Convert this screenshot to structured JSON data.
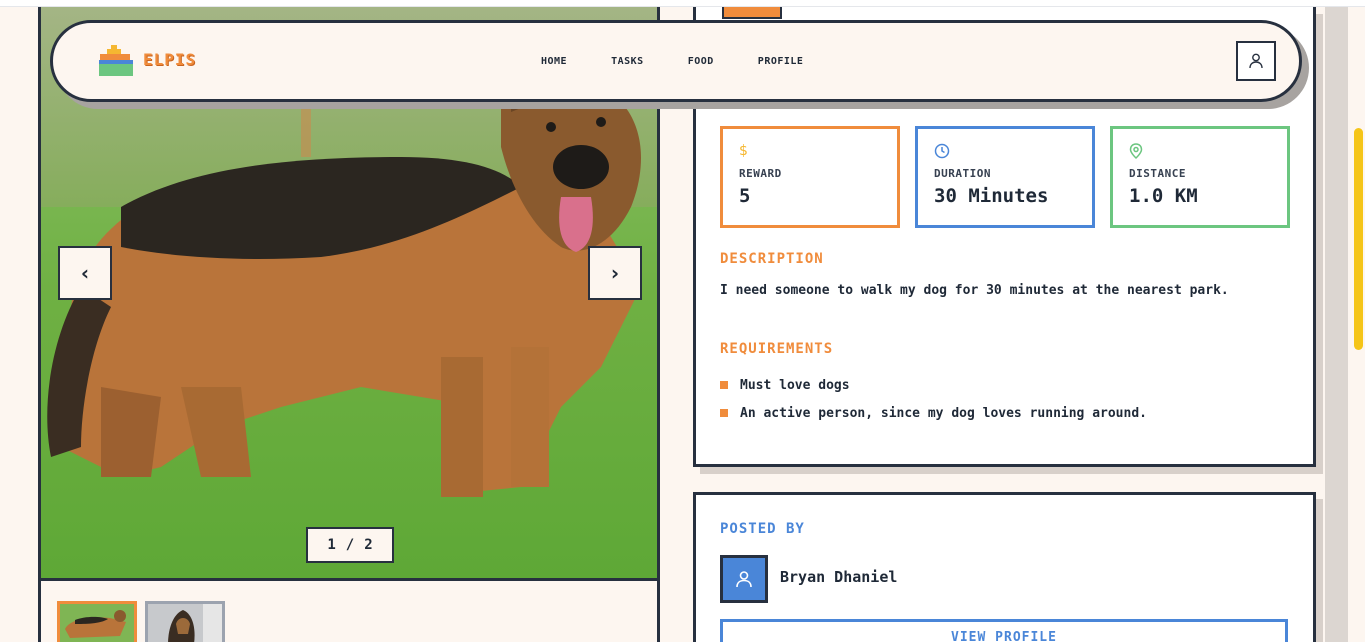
{
  "header": {
    "brand": "ELPIS",
    "nav": [
      "HOME",
      "TASKS",
      "FOOD",
      "PROFILE"
    ]
  },
  "gallery": {
    "current": "1",
    "separator": "/",
    "total": "2"
  },
  "stats": {
    "reward": {
      "label": "REWARD",
      "value": "5",
      "icon": "dollar-icon"
    },
    "duration": {
      "label": "DURATION",
      "value": "30 Minutes",
      "icon": "clock-icon"
    },
    "distance": {
      "label": "DISTANCE",
      "value": "1.0 KM",
      "icon": "map-pin-icon"
    }
  },
  "description": {
    "heading": "DESCRIPTION",
    "text": "I need someone to walk my dog for 30 minutes at the nearest park."
  },
  "requirements": {
    "heading": "REQUIREMENTS",
    "items": [
      "Must love dogs",
      "An active person, since my dog loves running around."
    ]
  },
  "posted_by": {
    "heading": "POSTED BY",
    "name": "Bryan Dhaniel",
    "button": "VIEW PROFILE"
  },
  "colors": {
    "orange": "#f08c3c",
    "blue": "#4a86d8",
    "green": "#6cc680",
    "dark": "#27303f",
    "cream": "#fdf6f0",
    "scrollbar": "#f5c518"
  }
}
